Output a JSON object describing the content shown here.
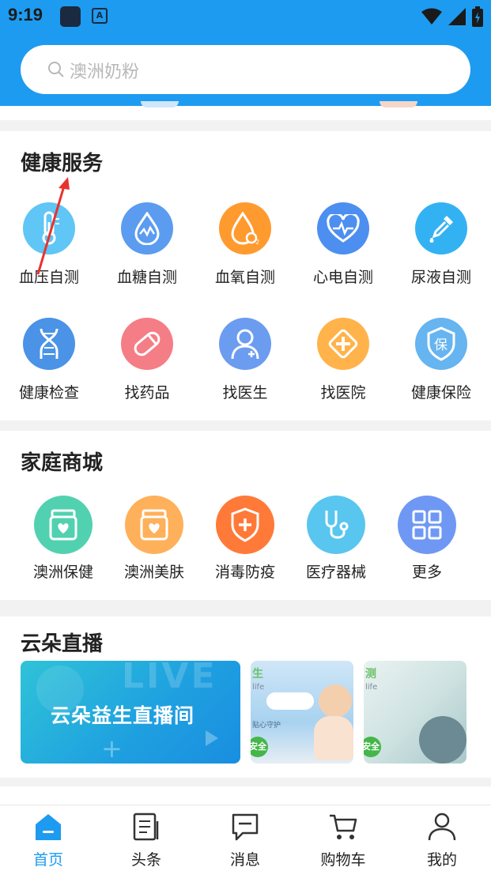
{
  "status_bar": {
    "time": "9:19",
    "icons": [
      "app-icon",
      "font-icon",
      "wifi-icon",
      "signal-icon",
      "battery-icon"
    ]
  },
  "search": {
    "placeholder": "澳洲奶粉"
  },
  "health": {
    "title": "健康服务",
    "items": [
      {
        "label": "血压自测",
        "icon": "thermometer-icon",
        "color": "#5fc6f5"
      },
      {
        "label": "血糖自测",
        "icon": "blood-drop-icon",
        "color": "#5b9cf0"
      },
      {
        "label": "血氧自测",
        "icon": "oxygen-drop-icon",
        "color": "#ff9a2e"
      },
      {
        "label": "心电自测",
        "icon": "heart-pulse-icon",
        "color": "#4d8ff0"
      },
      {
        "label": "尿液自测",
        "icon": "dropper-icon",
        "color": "#33b2f3"
      },
      {
        "label": "健康检查",
        "icon": "dna-icon",
        "color": "#4a93e6"
      },
      {
        "label": "找药品",
        "icon": "capsule-icon",
        "color": "#f57d86"
      },
      {
        "label": "找医生",
        "icon": "doctor-icon",
        "color": "#6b9cf0"
      },
      {
        "label": "找医院",
        "icon": "hospital-cross-icon",
        "color": "#ffb34a"
      },
      {
        "label": "健康保险",
        "icon": "insurance-shield-icon",
        "color": "#66b4f0"
      }
    ]
  },
  "mall": {
    "title": "家庭商城",
    "items": [
      {
        "label": "澳洲保健",
        "icon": "health-jar-icon",
        "color": "#52d1b0"
      },
      {
        "label": "澳洲美肤",
        "icon": "beauty-jar-icon",
        "color": "#ffb05a"
      },
      {
        "label": "消毒防疫",
        "icon": "shield-plus-icon",
        "color": "#ff7a38"
      },
      {
        "label": "医疗器械",
        "icon": "stethoscope-icon",
        "color": "#58c6ef"
      },
      {
        "label": "更多",
        "icon": "grid-icon",
        "color": "#6f98f4"
      }
    ]
  },
  "live": {
    "title": "云朵直播",
    "banner_main": {
      "text": "云朵益生直播间",
      "watermark": "LIVE"
    },
    "banner_2": {
      "top": "生",
      "sub": "life",
      "line": "贴心守护",
      "badge": "安全"
    },
    "banner_3": {
      "top": "测",
      "sub": "life",
      "badge": "安全"
    }
  },
  "tabs": [
    {
      "label": "首页",
      "icon": "home-icon",
      "active": true
    },
    {
      "label": "头条",
      "icon": "news-icon",
      "active": false
    },
    {
      "label": "消息",
      "icon": "message-icon",
      "active": false
    },
    {
      "label": "购物车",
      "icon": "cart-icon",
      "active": false
    },
    {
      "label": "我的",
      "icon": "user-icon",
      "active": false
    }
  ],
  "colors": {
    "primary": "#1d9bf0",
    "annotation_arrow": "#e8322e"
  }
}
